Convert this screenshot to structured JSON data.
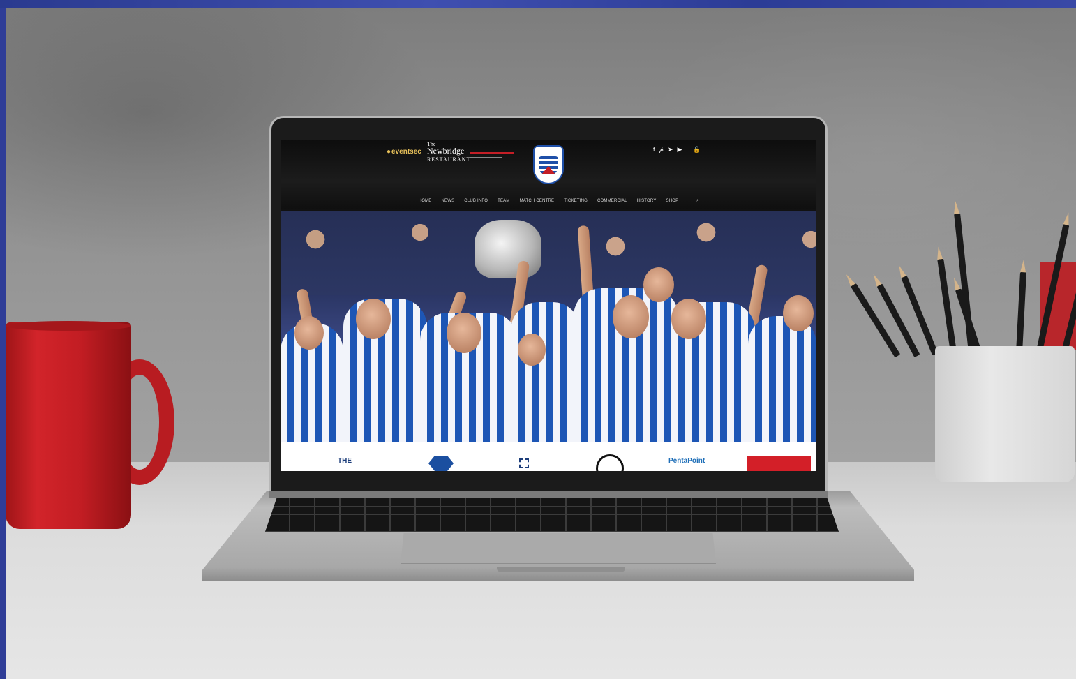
{
  "site": {
    "sponsors_header": {
      "eventsec": "eventsec",
      "newbridge_the": "The",
      "newbridge_name": "Newbridge",
      "newbridge_restaurant": "RESTAURANT"
    },
    "social_icons": [
      "facebook-icon",
      "pinterest-icon",
      "twitter-icon",
      "youtube-icon",
      "lock-icon"
    ],
    "social_glyphs": [
      "f",
      "𝓅",
      "➤",
      "▶",
      "🔒"
    ],
    "nav": [
      "HOME",
      "NEWS",
      "CLUB INFO",
      "TEAM",
      "MATCH CENTRE",
      "TICKETING",
      "COMMERCIAL",
      "HISTORY",
      "SHOP"
    ],
    "search_glyph": "⌕",
    "sponsor_bar": {
      "first": "THE",
      "fifth": "PentaPoint"
    }
  },
  "colors": {
    "club_blue": "#1e4fa8",
    "club_red": "#c41e26",
    "header_bg": "#0d0d0d",
    "mug_red": "#c21d23"
  }
}
